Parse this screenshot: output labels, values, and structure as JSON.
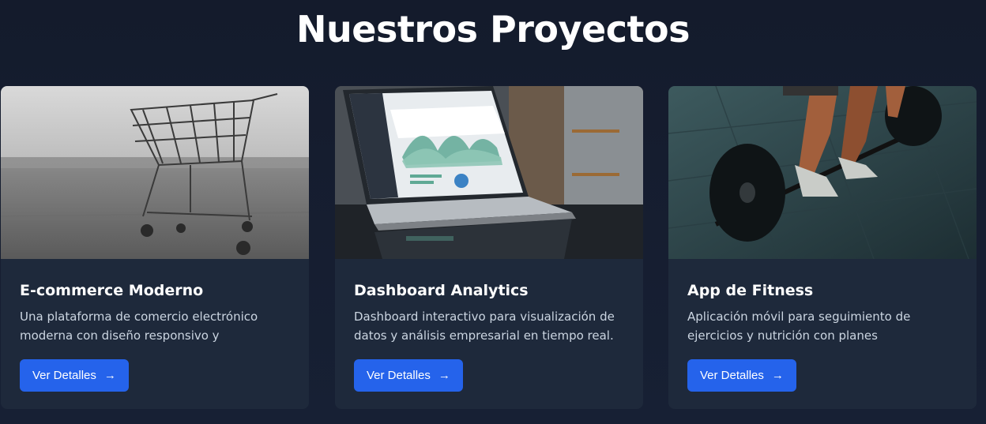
{
  "section": {
    "title": "Nuestros Proyectos"
  },
  "projects": [
    {
      "title": "E-commerce Moderno",
      "description": "Una plataforma de comercio electrónico moderna con diseño responsivo y experiencia...",
      "button_label": "Ver Detalles",
      "image": "shopping-cart-photo"
    },
    {
      "title": "Dashboard Analytics",
      "description": "Dashboard interactivo para visualización de datos y análisis empresarial en tiempo real.",
      "button_label": "Ver Detalles",
      "image": "laptop-dashboard-photo"
    },
    {
      "title": "App de Fitness",
      "description": "Aplicación móvil para seguimiento de ejercicios y nutrición con planes personalizados.",
      "button_label": "Ver Detalles",
      "image": "barbell-lift-photo"
    }
  ],
  "icons": {
    "button_arrow": "arrow-right-icon"
  },
  "colors": {
    "accent": "#2563eb",
    "card_bg": "#1e293b",
    "page_bg": "#161d2f"
  }
}
